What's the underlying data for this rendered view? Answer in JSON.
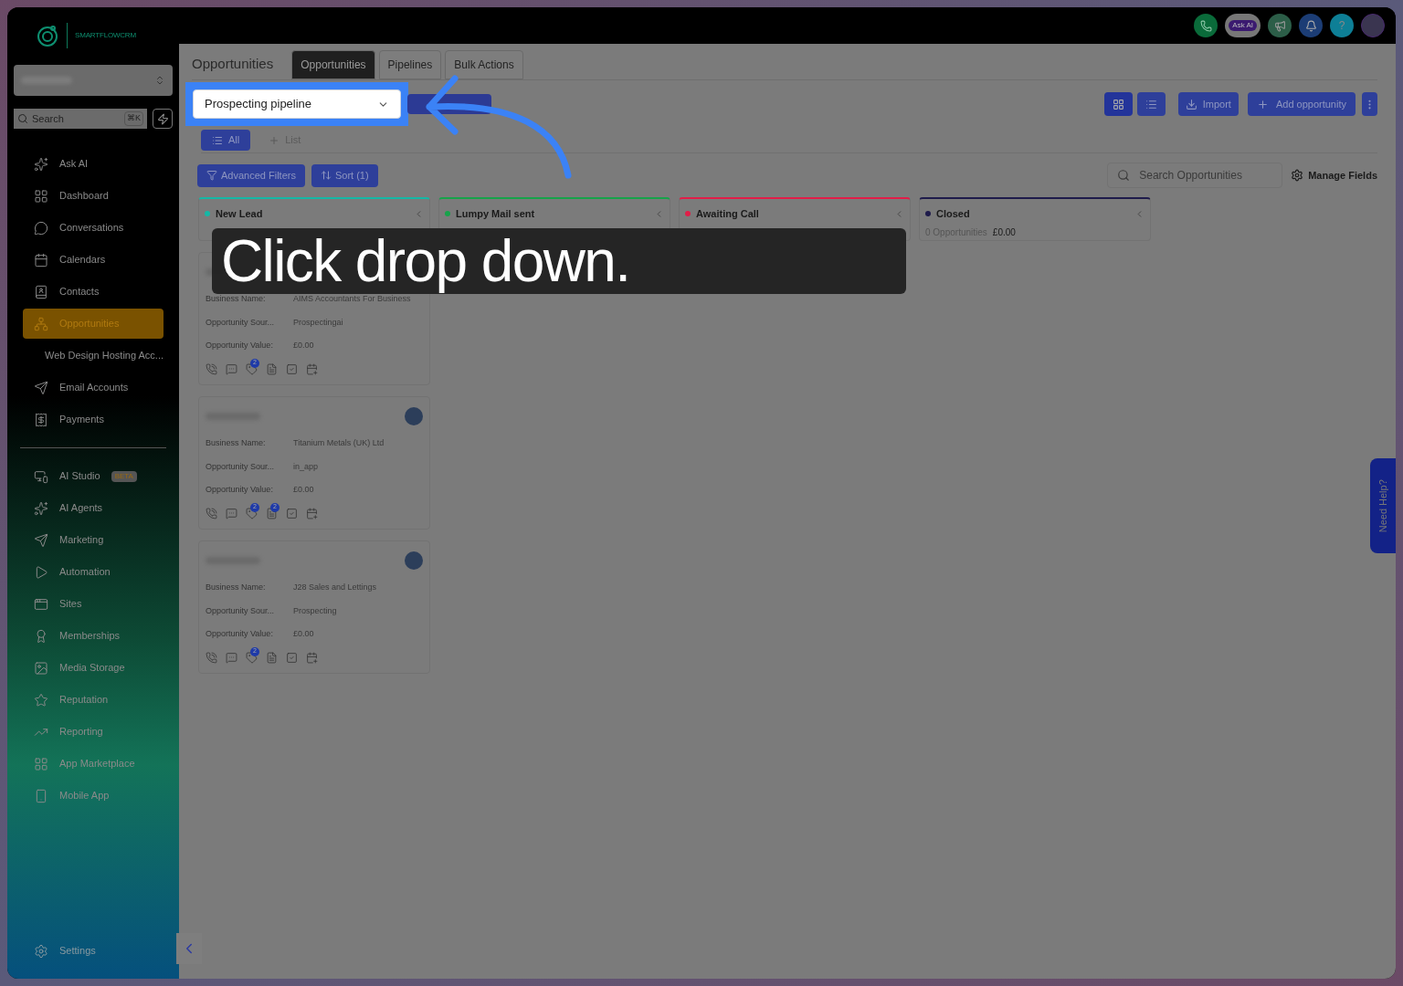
{
  "brand": {
    "name": "SMARTFLOWCRM"
  },
  "sidebar": {
    "search": {
      "placeholder": "Search",
      "shortcut": "⌘K"
    },
    "items": [
      {
        "kind": "sparkles",
        "label": "Ask AI",
        "selected": false
      },
      {
        "kind": "dashboard",
        "label": "Dashboard",
        "selected": false
      },
      {
        "kind": "chat",
        "label": "Conversations",
        "selected": false
      },
      {
        "kind": "calendar",
        "label": "Calendars",
        "selected": false
      },
      {
        "kind": "contacts",
        "label": "Contacts",
        "selected": false
      },
      {
        "kind": "network",
        "label": "Opportunities",
        "selected": true
      },
      {
        "kind": "server",
        "label": "Web Design Hosting Acc...",
        "selected": false
      },
      {
        "kind": "send",
        "label": "Email Accounts",
        "selected": false
      },
      {
        "kind": "receipt",
        "label": "Payments",
        "selected": false
      }
    ],
    "items2": [
      {
        "kind": "studio",
        "label": "AI Studio",
        "badge": "BETA",
        "selected": false
      },
      {
        "kind": "sparkles",
        "label": "AI Agents",
        "selected": false
      },
      {
        "kind": "send",
        "label": "Marketing",
        "selected": false
      },
      {
        "kind": "play",
        "label": "Automation",
        "selected": false
      },
      {
        "kind": "site",
        "label": "Sites",
        "selected": false
      },
      {
        "kind": "award",
        "label": "Memberships",
        "selected": false
      },
      {
        "kind": "image",
        "label": "Media Storage",
        "selected": false
      },
      {
        "kind": "star",
        "label": "Reputation",
        "selected": false
      },
      {
        "kind": "trend",
        "label": "Reporting",
        "selected": false
      },
      {
        "kind": "dashboard",
        "label": "App Marketplace",
        "selected": false
      },
      {
        "kind": "phone",
        "label": "Mobile App",
        "selected": false
      }
    ],
    "settings": "Settings"
  },
  "topbar": {
    "ask_ai": "Ask AI",
    "help": "?"
  },
  "page": {
    "title": "Opportunities",
    "tabs": [
      {
        "label": "Opportunities",
        "selected": true
      },
      {
        "label": "Pipelines",
        "selected": false
      },
      {
        "label": "Bulk Actions",
        "selected": false
      }
    ],
    "pipeline": "Prospecting pipeline",
    "views": [
      {
        "kind": "grid",
        "selected": true
      },
      {
        "kind": "list",
        "selected": false
      }
    ],
    "import": "Import",
    "add": "Add opportunity",
    "lists": [
      {
        "label": "All",
        "selected": true
      },
      {
        "label": "List",
        "selected": false
      }
    ],
    "filters": "Advanced Filters",
    "sort": "Sort (1)",
    "search": {
      "placeholder": "Search Opportunities"
    },
    "manage": "Manage Fields",
    "columns": [
      {
        "name": "New Lead",
        "color": "#14b8a6"
      },
      {
        "name": "Lumpy Mail sent",
        "color": "#16a34a"
      },
      {
        "name": "Awaiting Call",
        "color": "#e11d48"
      },
      {
        "name": "Closed",
        "color": "#1e1b4b",
        "count": "0 Opportunities",
        "value": "£0.00"
      }
    ],
    "cards": [
      {
        "fields": [
          {
            "label": "Business Name:",
            "value": "AIMS Accountants For Business"
          },
          {
            "label": "Opportunity Sour...",
            "value": "Prospectingai"
          },
          {
            "label": "Opportunity Value:",
            "value": "£0.00"
          }
        ],
        "actions": [
          {
            "kind": "phone"
          },
          {
            "kind": "chat"
          },
          {
            "kind": "tag",
            "badge": "2"
          },
          {
            "kind": "note"
          },
          {
            "kind": "task"
          },
          {
            "kind": "appointment"
          }
        ]
      },
      {
        "fields": [
          {
            "label": "Business Name:",
            "value": "Titanium Metals (UK) Ltd"
          },
          {
            "label": "Opportunity Sour...",
            "value": "in_app"
          },
          {
            "label": "Opportunity Value:",
            "value": "£0.00"
          }
        ],
        "actions": [
          {
            "kind": "phone"
          },
          {
            "kind": "chat"
          },
          {
            "kind": "tag",
            "badge": "2"
          },
          {
            "kind": "note",
            "badge": "2"
          },
          {
            "kind": "task"
          },
          {
            "kind": "appointment"
          }
        ]
      },
      {
        "fields": [
          {
            "label": "Business Name:",
            "value": "J28 Sales and Lettings"
          },
          {
            "label": "Opportunity Sour...",
            "value": "Prospecting"
          },
          {
            "label": "Opportunity Value:",
            "value": "£0.00"
          }
        ],
        "actions": [
          {
            "kind": "phone"
          },
          {
            "kind": "chat"
          },
          {
            "kind": "tag",
            "badge": "2"
          },
          {
            "kind": "note"
          },
          {
            "kind": "task"
          },
          {
            "kind": "appointment"
          }
        ]
      }
    ],
    "help": "Need Help?"
  },
  "caption": "Click drop down."
}
